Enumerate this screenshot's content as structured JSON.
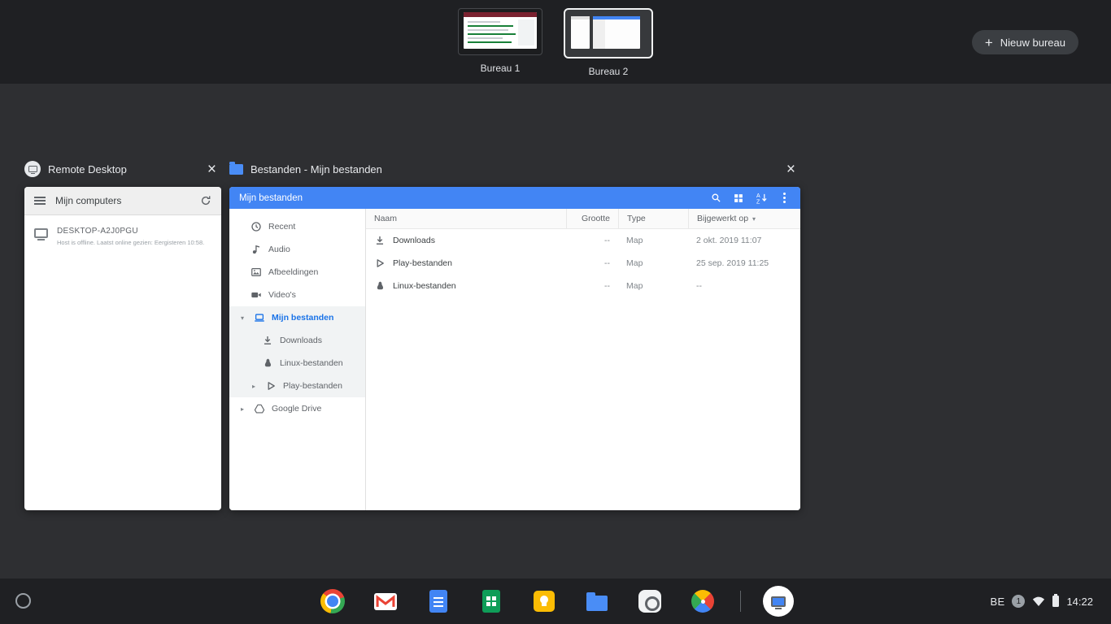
{
  "icons": {
    "close": "×",
    "chevron_down": "▾",
    "chevron_right": "▸",
    "sort_caret": "▾",
    "plus": "+"
  },
  "desks_bar": {
    "desks": [
      {
        "label": "Bureau 1"
      },
      {
        "label": "Bureau 2"
      }
    ],
    "new_desk_label": "Nieuw bureau"
  },
  "windows": {
    "remote": {
      "title": "Remote Desktop",
      "toolbar_title": "Mijn computers",
      "computer_name": "DESKTOP-A2J0PGU",
      "computer_status": "Host is offline.  Laatst online gezien: Eergisteren 10:58."
    },
    "files": {
      "title": "Bestanden - Mijn bestanden",
      "toolbar_title": "Mijn bestanden",
      "sidebar": [
        {
          "label": "Recent",
          "icon": "clock-icon"
        },
        {
          "label": "Audio",
          "icon": "audio-icon"
        },
        {
          "label": "Afbeeldingen",
          "icon": "image-icon"
        },
        {
          "label": "Video's",
          "icon": "video-icon"
        },
        {
          "label": "Mijn bestanden",
          "icon": "laptop-icon",
          "selected": true,
          "expanded": true
        },
        {
          "label": "Downloads",
          "icon": "download-icon"
        },
        {
          "label": "Linux-bestanden",
          "icon": "linux-icon"
        },
        {
          "label": "Play-bestanden",
          "icon": "play-icon"
        },
        {
          "label": "Google Drive",
          "icon": "drive-icon"
        }
      ],
      "table": {
        "columns": [
          "Naam",
          "Grootte",
          "Type",
          "Bijgewerkt op"
        ],
        "rows": [
          {
            "name": "Downloads",
            "icon": "download-icon",
            "size": "--",
            "type": "Map",
            "modified": "2 okt. 2019 11:07"
          },
          {
            "name": "Play-bestanden",
            "icon": "play-icon",
            "size": "--",
            "type": "Map",
            "modified": "25 sep. 2019 11:25"
          },
          {
            "name": "Linux-bestanden",
            "icon": "linux-icon",
            "size": "--",
            "type": "Map",
            "modified": "--"
          }
        ]
      }
    }
  },
  "shelf": {
    "app_icons": [
      "chrome-icon",
      "gmail-icon",
      "docs-icon",
      "sheets-icon",
      "keep-icon",
      "files-icon",
      "camera-icon",
      "photos-icon",
      "remote-desktop-icon"
    ],
    "status": {
      "keyboard_layout": "BE",
      "notification_count": "1",
      "time": "14:22"
    }
  },
  "colors": {
    "files_header_blue": "#4285f4",
    "selected_nav_blue": "#1a73e8",
    "bar_bg": "#1f2023",
    "overview_bg": "#2e2f32"
  }
}
